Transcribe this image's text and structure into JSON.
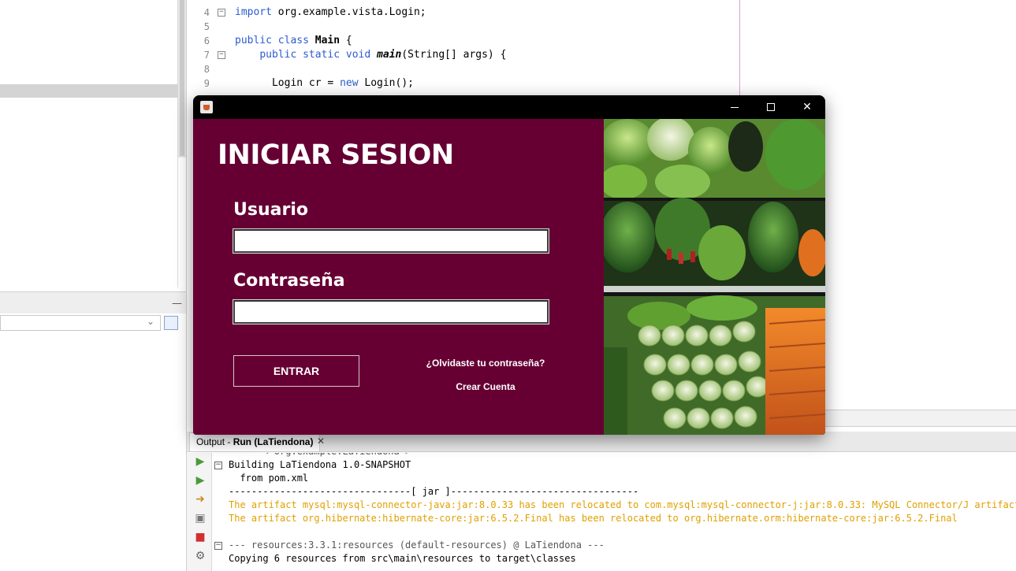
{
  "editor": {
    "lines": [
      {
        "num": "4",
        "fold": true,
        "tokens": [
          {
            "t": "import",
            "c": "kw"
          },
          {
            "t": " org.example.vista.Login;",
            "c": ""
          }
        ]
      },
      {
        "num": "5",
        "fold": false,
        "tokens": []
      },
      {
        "num": "6",
        "fold": false,
        "tokens": [
          {
            "t": "public",
            "c": "kw"
          },
          {
            "t": " ",
            "c": ""
          },
          {
            "t": "class",
            "c": "kw"
          },
          {
            "t": " ",
            "c": ""
          },
          {
            "t": "Main",
            "c": "bold"
          },
          {
            "t": " {",
            "c": ""
          }
        ]
      },
      {
        "num": "7",
        "fold": true,
        "tokens": [
          {
            "t": "    ",
            "c": ""
          },
          {
            "t": "public",
            "c": "kw"
          },
          {
            "t": " ",
            "c": ""
          },
          {
            "t": "static",
            "c": "kw"
          },
          {
            "t": " ",
            "c": ""
          },
          {
            "t": "void",
            "c": "kw"
          },
          {
            "t": " ",
            "c": ""
          },
          {
            "t": "main",
            "c": "ital"
          },
          {
            "t": "(String[] args) {",
            "c": ""
          }
        ]
      },
      {
        "num": "8",
        "fold": false,
        "tokens": []
      },
      {
        "num": "9",
        "fold": false,
        "tokens": [
          {
            "t": "      Login cr = ",
            "c": ""
          },
          {
            "t": "new",
            "c": "kw"
          },
          {
            "t": " Login();",
            "c": ""
          }
        ]
      }
    ]
  },
  "output": {
    "tab_prefix": "Output - ",
    "tab_bold": "Run (LaTiendona)",
    "tab_close": "✕",
    "lines": [
      {
        "text": "      < org.example:LaTiendona >",
        "style": "gray",
        "fold": false
      },
      {
        "text": "Building LaTiendona 1.0-SNAPSHOT",
        "style": "",
        "fold": true
      },
      {
        "text": "  from pom.xml",
        "style": "",
        "fold": false
      },
      {
        "text": "--------------------------------[ jar ]---------------------------------",
        "style": "",
        "fold": false
      },
      {
        "text": "The artifact mysql:mysql-connector-java:jar:8.0.33 has been relocated to com.mysql:mysql-connector-j:jar:8.0.33: MySQL Connector/J artifacts mo",
        "style": "warn",
        "fold": false
      },
      {
        "text": "The artifact org.hibernate:hibernate-core:jar:6.5.2.Final has been relocated to org.hibernate.orm:hibernate-core:jar:6.5.2.Final",
        "style": "warn",
        "fold": false
      },
      {
        "text": "",
        "style": "",
        "fold": false
      },
      {
        "text": "--- resources:3.3.1:resources (default-resources) @ LaTiendona ---",
        "style": "gray",
        "fold": true
      },
      {
        "text": "Copying 6 resources from src\\main\\resources to target\\classes",
        "style": "",
        "fold": false
      }
    ]
  },
  "login": {
    "title": "INICIAR SESION",
    "user_label": "Usuario",
    "user_value": "",
    "pass_label": "Contraseña",
    "pass_value": "",
    "submit_label": "ENTRAR",
    "forgot_link": "¿Olvidaste tu contraseña?",
    "create_link": "Crear Cuenta",
    "colors": {
      "panel": "#660033",
      "text": "#ffffff"
    }
  },
  "window": {
    "close_glyph": "✕"
  }
}
